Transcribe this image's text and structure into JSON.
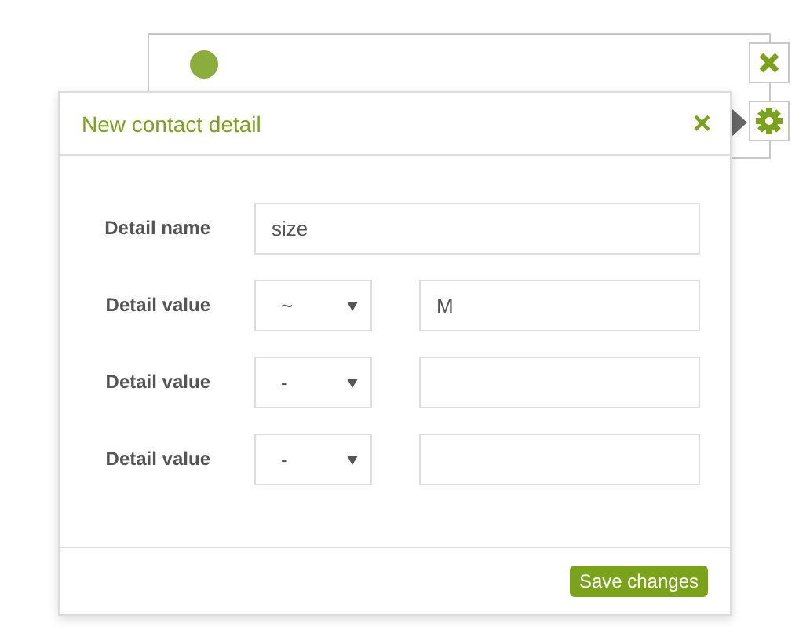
{
  "dialog": {
    "title": "New contact detail",
    "close_label": "×",
    "name_row": {
      "label": "Detail name",
      "value": "size"
    },
    "value_rows": [
      {
        "label": "Detail value",
        "operator": "~",
        "value": "M"
      },
      {
        "label": "Detail value",
        "operator": "-",
        "value": ""
      },
      {
        "label": "Detail value",
        "operator": "-",
        "value": ""
      }
    ],
    "save_button": "Save changes"
  }
}
